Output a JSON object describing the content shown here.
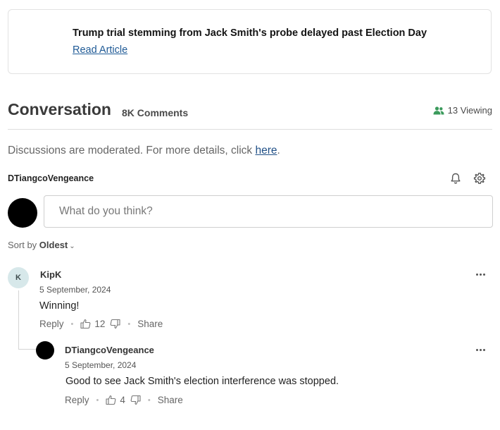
{
  "article": {
    "title": "Trump trial stemming from Jack Smith's probe delayed past Election Day",
    "link_label": "Read Article"
  },
  "conversation": {
    "title": "Conversation",
    "comment_count": "8K Comments",
    "viewing": "13 Viewing"
  },
  "moderation": {
    "text": "Discussions are moderated. For more details, click ",
    "link": "here",
    "suffix": "."
  },
  "current_user": {
    "name": "DTiangcoVengeance"
  },
  "input": {
    "placeholder": "What do you think?"
  },
  "sort": {
    "label": "Sort by ",
    "value": "Oldest"
  },
  "comments": [
    {
      "avatar_letter": "K",
      "author": "KipK",
      "date": "5 September, 2024",
      "body": "Winning!",
      "reply_label": "Reply",
      "likes": "12",
      "share_label": "Share"
    },
    {
      "author": "DTiangcoVengeance",
      "date": "5 September, 2024",
      "body": "Good to see Jack Smith's election interference was stopped.",
      "reply_label": "Reply",
      "likes": "4",
      "share_label": "Share"
    }
  ],
  "colors": {
    "link": "#1f5a96",
    "viewing_icon": "#3a9a5b",
    "avatar_k_bg": "#d7e8ea"
  }
}
